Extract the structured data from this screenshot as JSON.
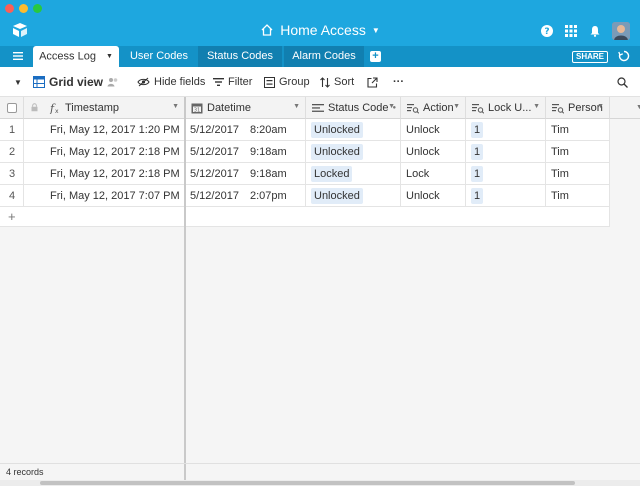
{
  "window": {
    "base_title": "Home Access"
  },
  "tabs": {
    "items": [
      {
        "label": "Access Log",
        "active": true
      },
      {
        "label": "User Codes"
      },
      {
        "label": "Status Codes"
      },
      {
        "label": "Alarm Codes"
      }
    ],
    "share_label": "SHARE"
  },
  "toolbar": {
    "view_name": "Grid view",
    "hide_fields": "Hide fields",
    "filter": "Filter",
    "group": "Group",
    "sort": "Sort",
    "more": "···"
  },
  "grid": {
    "columns": [
      {
        "label": "Timestamp",
        "icon": "formula-icon"
      },
      {
        "label": "Datetime",
        "icon": "calendar-icon"
      },
      {
        "label": "Status Code",
        "icon": "link-record-icon"
      },
      {
        "label": "Action",
        "icon": "lookup-icon"
      },
      {
        "label": "Lock U...",
        "icon": "lookup-icon"
      },
      {
        "label": "Person",
        "icon": "lookup-icon"
      }
    ],
    "rows": [
      {
        "num": "1",
        "timestamp": "Fri, May 12, 2017 1:20 PM",
        "date": "5/12/2017",
        "time": "8:20am",
        "status": "Unlocked",
        "action": "Unlock",
        "lock": "1",
        "person": "Tim"
      },
      {
        "num": "2",
        "timestamp": "Fri, May 12, 2017 2:18 PM",
        "date": "5/12/2017",
        "time": "9:18am",
        "status": "Unlocked",
        "action": "Unlock",
        "lock": "1",
        "person": "Tim"
      },
      {
        "num": "3",
        "timestamp": "Fri, May 12, 2017 2:18 PM",
        "date": "5/12/2017",
        "time": "9:18am",
        "status": "Locked",
        "action": "Lock",
        "lock": "1",
        "person": "Tim"
      },
      {
        "num": "4",
        "timestamp": "Fri, May 12, 2017 7:07 PM",
        "date": "5/12/2017",
        "time": "2:07pm",
        "status": "Unlocked",
        "action": "Unlock",
        "lock": "1",
        "person": "Tim"
      }
    ]
  },
  "footer": {
    "record_count": "4 records"
  },
  "colors": {
    "header_blue": "#1ea7df",
    "tab_bar_blue": "#1492c7",
    "chip_bg": "#e1ecf8"
  }
}
